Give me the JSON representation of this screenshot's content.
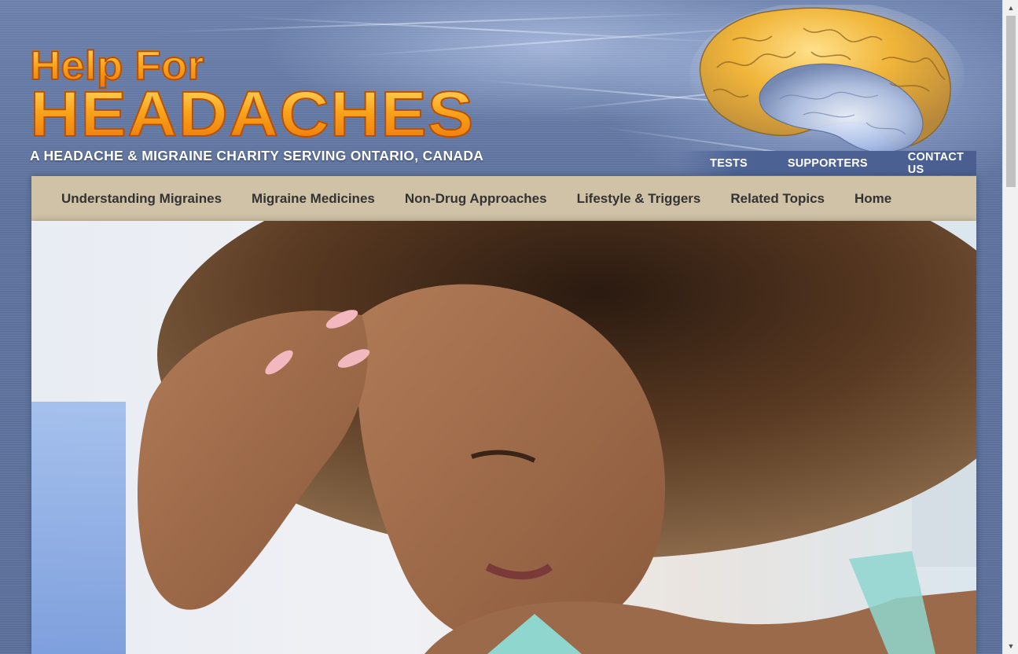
{
  "logo": {
    "line1": "Help For",
    "line2": "HEADACHES",
    "tagline": "A HEADACHE & MIGRAINE CHARITY SERVING ONTARIO, CANADA"
  },
  "utility_nav": [
    {
      "label": "TESTS"
    },
    {
      "label": "SUPPORTERS"
    },
    {
      "label": "CONTACT US"
    }
  ],
  "main_nav": [
    {
      "label": "Understanding Migraines"
    },
    {
      "label": "Migraine Medicines"
    },
    {
      "label": "Non-Drug Approaches"
    },
    {
      "label": "Lifestyle & Triggers"
    },
    {
      "label": "Related Topics"
    },
    {
      "label": "Home"
    }
  ],
  "hero": {
    "image": "woman-with-headache-photo"
  },
  "colors": {
    "page_bg": "#5b6f99",
    "logo_orange": "#f9a31a",
    "nav_bg": "#cfc2a7",
    "nav_text": "#333333",
    "util_nav_bg": "#4a5f90"
  },
  "icons": {
    "brain": "brain-icon",
    "scroll_up": "arrow-up-icon",
    "scroll_down": "arrow-down-icon"
  }
}
